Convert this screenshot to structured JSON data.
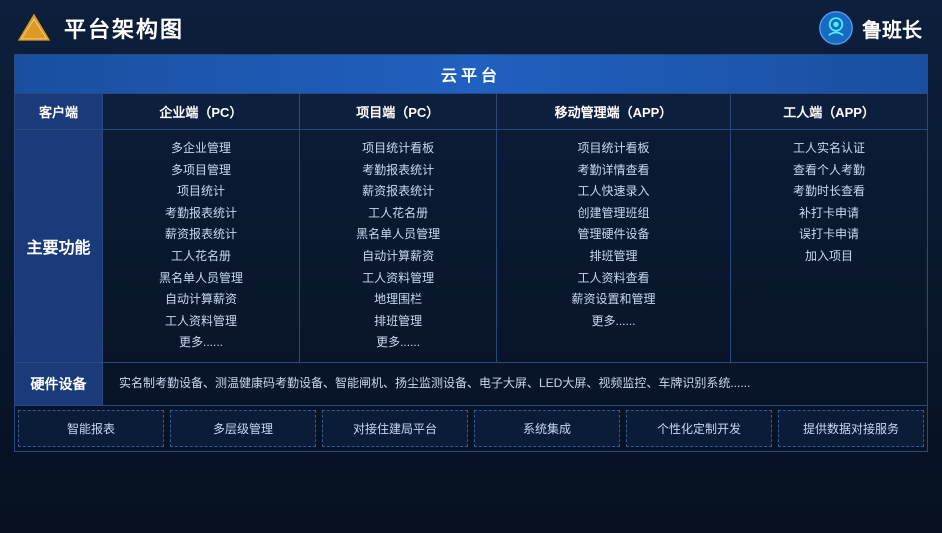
{
  "header": {
    "title": "平台架构图",
    "brand": "鲁班长"
  },
  "cloud": {
    "label": "云平台"
  },
  "columns": {
    "client": "客户端",
    "enterprise": "企业端（PC）",
    "project": "项目端（PC）",
    "mobile": "移动管理端（APP）",
    "worker": "工人端（APP）"
  },
  "rows": {
    "main_function": {
      "label": "主要功能",
      "enterprise_features": [
        "多企业管理",
        "多项目管理",
        "项目统计",
        "考勤报表统计",
        "薪资报表统计",
        "工人花名册",
        "黑名单人员管理",
        "自动计算薪资",
        "工人资料管理",
        "更多......"
      ],
      "project_features": [
        "项目统计看板",
        "考勤报表统计",
        "薪资报表统计",
        "工人花名册",
        "黑名单人员管理",
        "自动计算薪资",
        "工人资料管理",
        "地理围栏",
        "排班管理",
        "更多......"
      ],
      "mobile_features": [
        "项目统计看板",
        "考勤详情查看",
        "工人快速录入",
        "创建管理班组",
        "管理硬件设备",
        "排班管理",
        "工人资料查看",
        "薪资设置和管理",
        "更多......"
      ],
      "worker_features": [
        "工人实名认证",
        "查看个人考勤",
        "考勤时长查看",
        "补打卡申请",
        "误打卡申请",
        "加入项目"
      ]
    },
    "hardware": {
      "label": "硬件设备",
      "content": "实名制考勤设备、测温健康码考勤设备、智能闸机、扬尘监测设备、电子大屏、LED大屏、视频监控、车牌识别系统......"
    }
  },
  "features": [
    "智能报表",
    "多层级管理",
    "对接住建局平台",
    "系统集成",
    "个性化定制开发",
    "提供数据对接服务"
  ]
}
